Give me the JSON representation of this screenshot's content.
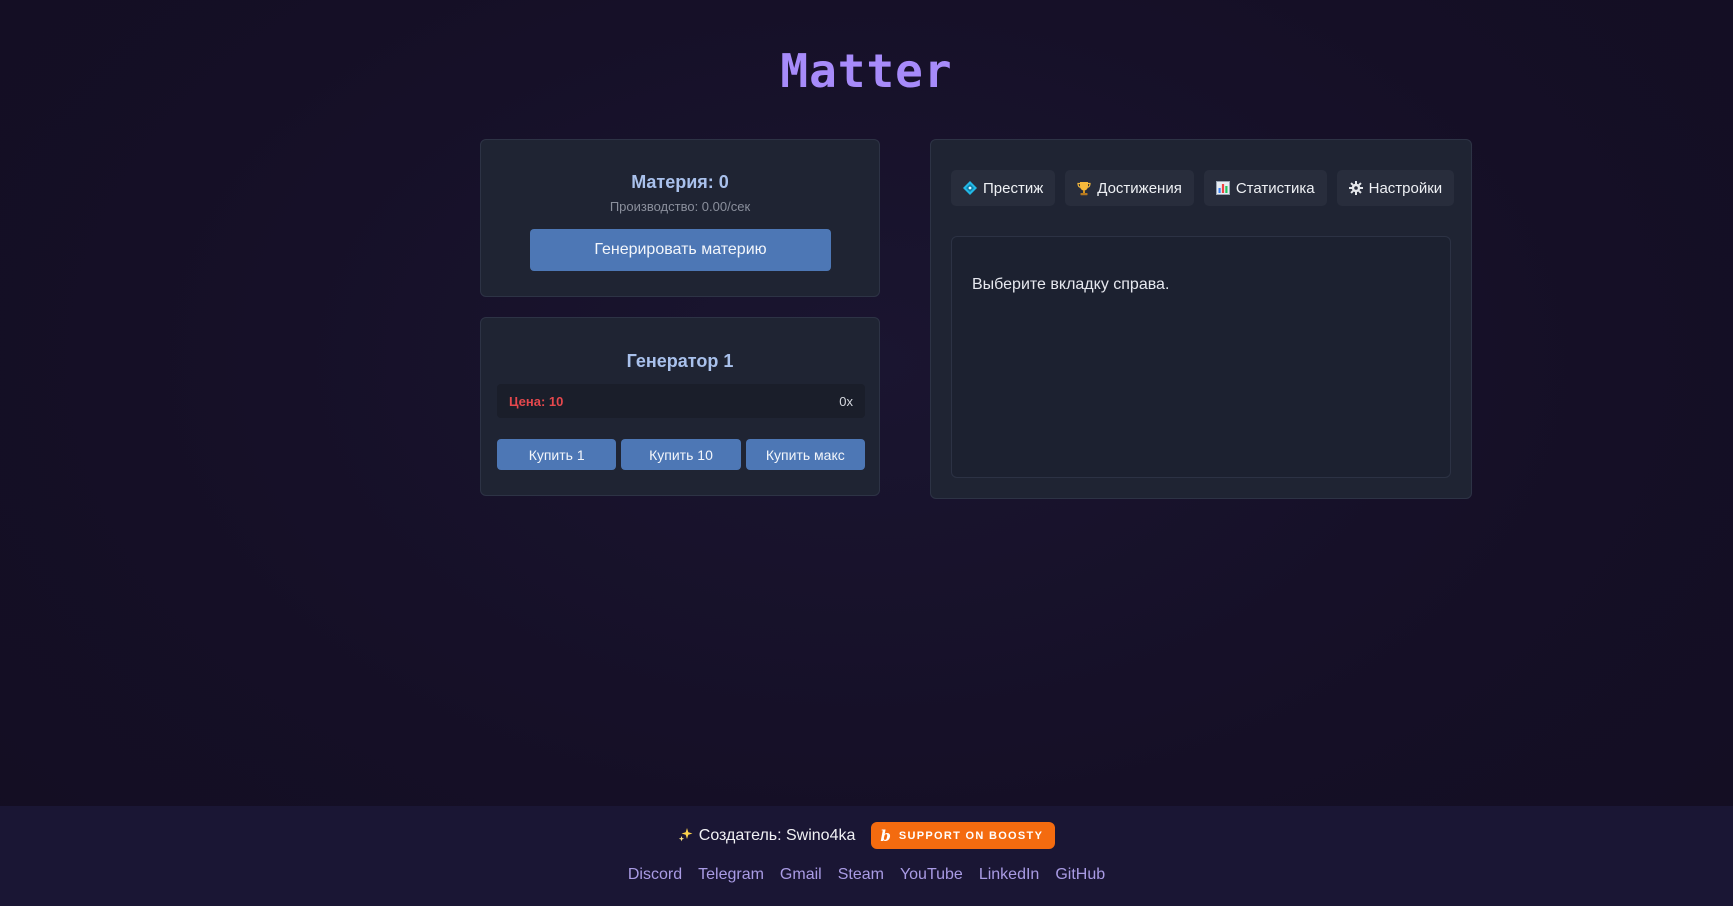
{
  "app": {
    "title": "Matter"
  },
  "matter": {
    "amount_label": "Материя: 0",
    "production_label": "Производство: 0.00/сек",
    "generate_button": "Генерировать материю"
  },
  "generator": {
    "title": "Генератор 1",
    "price_label": "Цена: 10",
    "owned": "0x",
    "buy_buttons": [
      "Купить 1",
      "Купить 10",
      "Купить макс"
    ]
  },
  "tabs": [
    {
      "label": "Престиж",
      "icon": "prestige-diamond-icon"
    },
    {
      "label": "Достижения",
      "icon": "trophy-icon"
    },
    {
      "label": "Статистика",
      "icon": "bar-chart-icon"
    },
    {
      "label": "Настройки",
      "icon": "gear-icon"
    }
  ],
  "panel": {
    "message": "Выберите вкладку справа."
  },
  "footer": {
    "creator": "Создатель: Swino4ka",
    "boosty_label": "SUPPORT ON BOOSTY",
    "links": [
      "Discord",
      "Telegram",
      "Gmail",
      "Steam",
      "YouTube",
      "LinkedIn",
      "GitHub"
    ]
  },
  "colors": {
    "background": "#161128",
    "accent_title": "#a78bfa",
    "card": "#1f2433",
    "button": "#4d77b5",
    "price_red": "#e5484d",
    "boosty_orange": "#f46b0f",
    "link": "#a99be4"
  }
}
